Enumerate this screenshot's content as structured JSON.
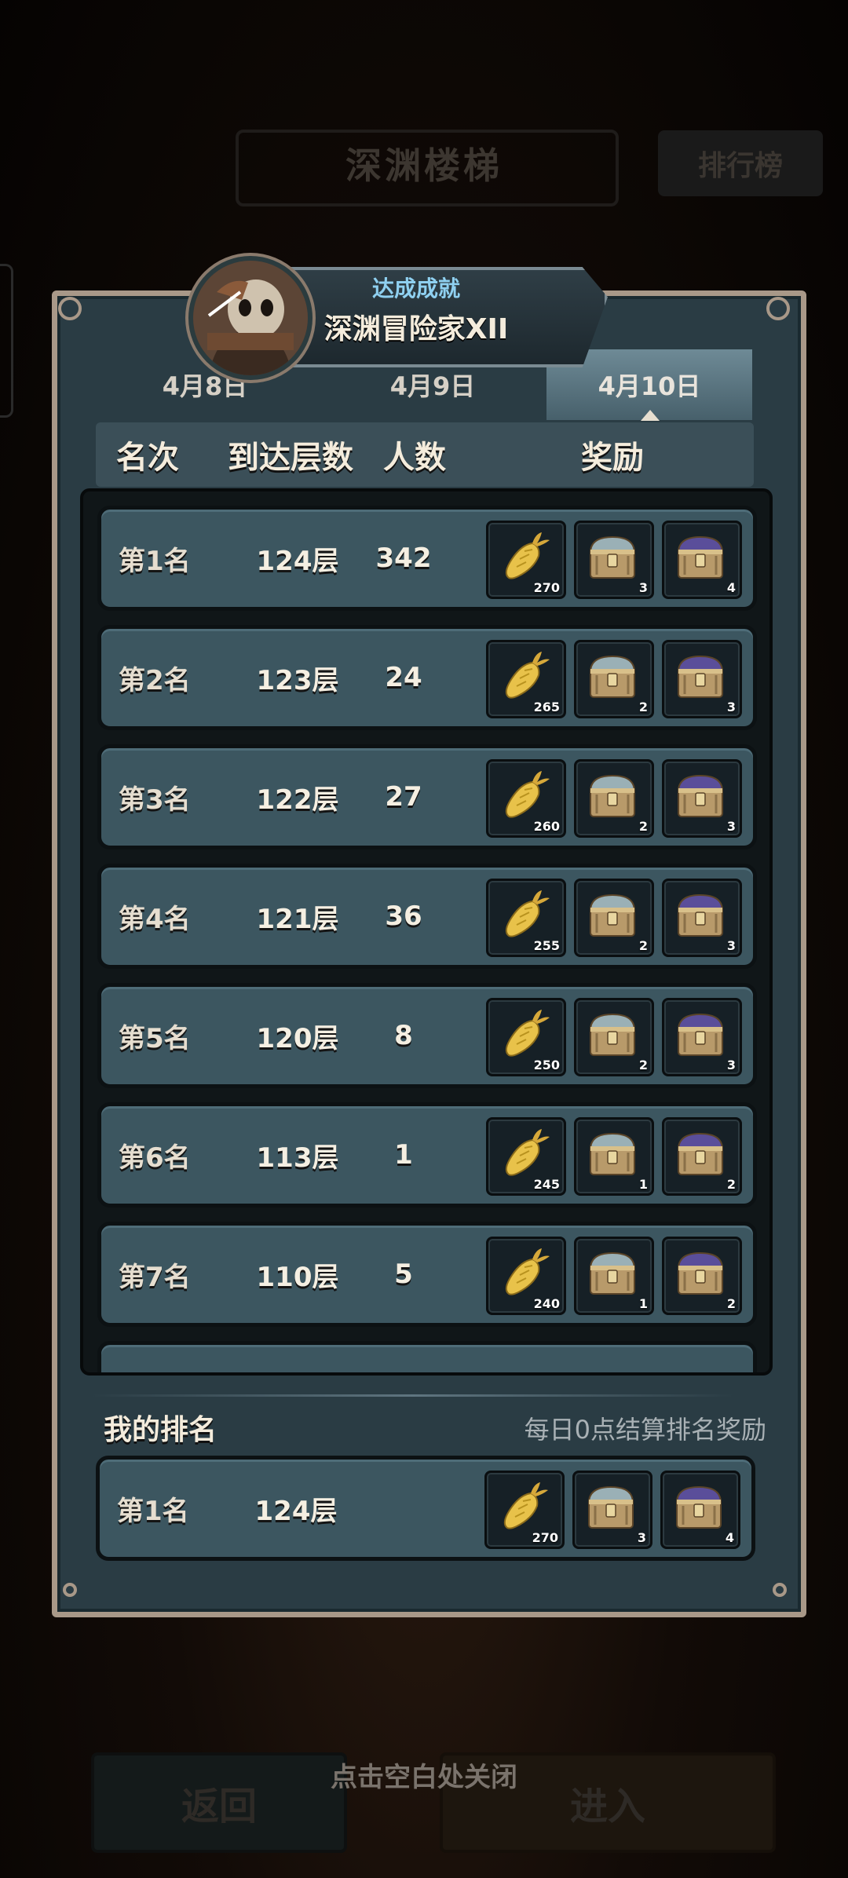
{
  "background": {
    "title": "深渊楼梯",
    "rank_button": "排行榜",
    "back_button": "返回",
    "enter_button": "进入",
    "close_hint": "点击空白处关闭"
  },
  "achievement": {
    "label": "达成成就",
    "name": "深渊冒险家XII"
  },
  "tabs": [
    {
      "label": "4月8日",
      "active": false
    },
    {
      "label": "4月9日",
      "active": false
    },
    {
      "label": "4月10日",
      "active": true
    }
  ],
  "columns": {
    "rank": "名次",
    "floor": "到达层数",
    "count": "人数",
    "reward": "奖励"
  },
  "rows": [
    {
      "rank": "第1名",
      "floor": "124层",
      "count": "342",
      "rewards": [
        "270",
        "3",
        "4"
      ]
    },
    {
      "rank": "第2名",
      "floor": "123层",
      "count": "24",
      "rewards": [
        "265",
        "2",
        "3"
      ]
    },
    {
      "rank": "第3名",
      "floor": "122层",
      "count": "27",
      "rewards": [
        "260",
        "2",
        "3"
      ]
    },
    {
      "rank": "第4名",
      "floor": "121层",
      "count": "36",
      "rewards": [
        "255",
        "2",
        "3"
      ]
    },
    {
      "rank": "第5名",
      "floor": "120层",
      "count": "8",
      "rewards": [
        "250",
        "2",
        "3"
      ]
    },
    {
      "rank": "第6名",
      "floor": "113层",
      "count": "1",
      "rewards": [
        "245",
        "1",
        "2"
      ]
    },
    {
      "rank": "第7名",
      "floor": "110层",
      "count": "5",
      "rewards": [
        "240",
        "1",
        "2"
      ]
    }
  ],
  "reward_icons": [
    "golden-carrot-icon",
    "silver-chest-icon",
    "purple-chest-icon"
  ],
  "my_rank": {
    "title": "我的排名",
    "note": "每日0点结算排名奖励",
    "rank": "第1名",
    "floor": "124层",
    "rewards": [
      "270",
      "3",
      "4"
    ]
  },
  "colors": {
    "panel": "#2a3c44",
    "panel_border": "#a89888",
    "row": "#3c5660",
    "active_tab": "#5b7682",
    "achievement_label": "#8fd0f0"
  }
}
